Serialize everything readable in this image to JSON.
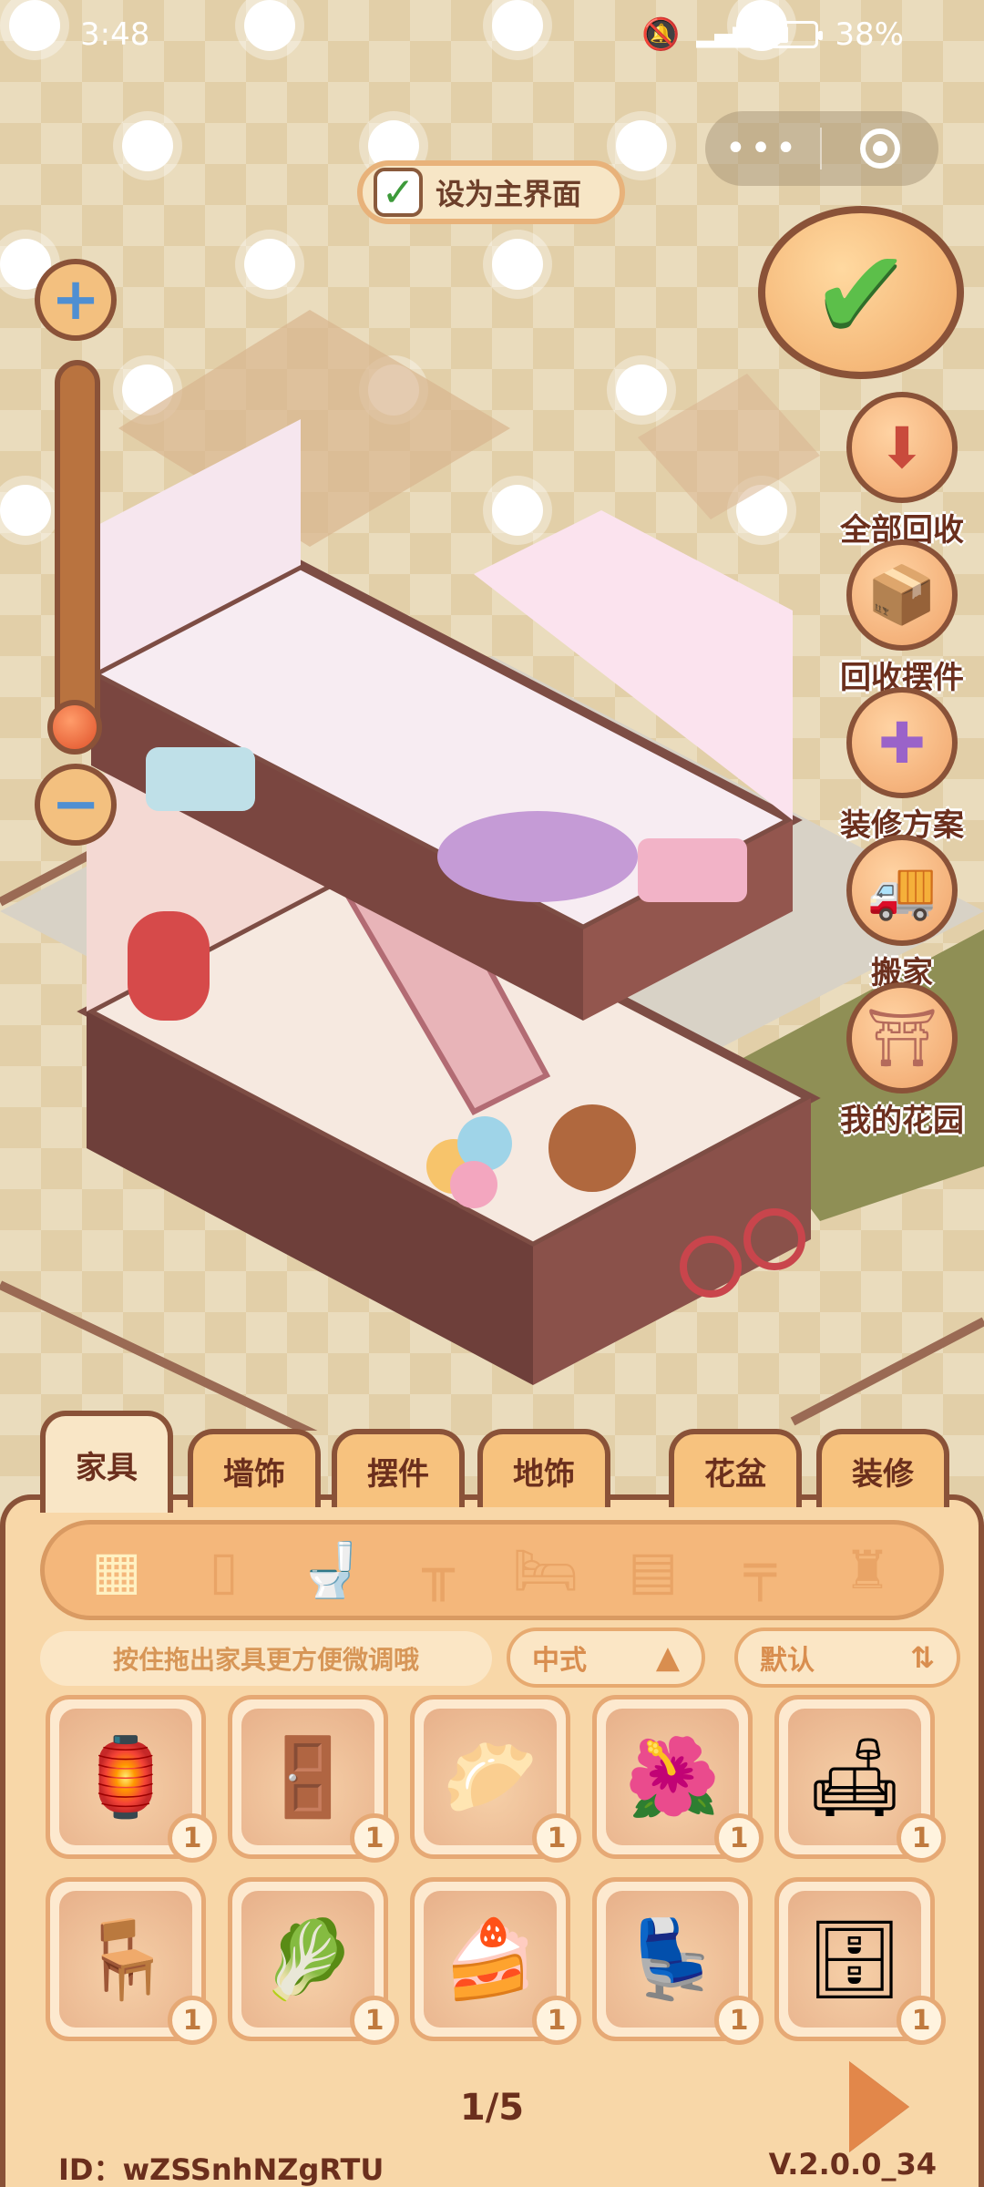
{
  "status_bar": {
    "time": "3:48",
    "battery": "38%",
    "battery_level": 0.38
  },
  "set_main": {
    "label": "设为主界面",
    "checked": true
  },
  "side_menu": [
    {
      "label": "全部回收",
      "icon": "recycle-all-box-icon"
    },
    {
      "label": "回收摆件",
      "icon": "recycle-ornament-box-icon"
    },
    {
      "label": "装修方案",
      "icon": "renovation-plan-icon"
    },
    {
      "label": "搬家",
      "icon": "moving-truck-icon"
    },
    {
      "label": "我的花园",
      "icon": "garden-arch-icon"
    }
  ],
  "tabs": [
    {
      "label": "家具",
      "active": true
    },
    {
      "label": "墙饰",
      "active": false
    },
    {
      "label": "摆件",
      "active": false
    },
    {
      "label": "地饰",
      "active": false
    },
    {
      "label": "花盆",
      "active": false
    },
    {
      "label": "装修",
      "active": false
    }
  ],
  "categories": [
    {
      "icon": "all-grid-icon",
      "active": true
    },
    {
      "icon": "fridge-icon",
      "active": false
    },
    {
      "icon": "toilet-icon",
      "active": false
    },
    {
      "icon": "stool-icon",
      "active": false
    },
    {
      "icon": "bed-icon",
      "active": false
    },
    {
      "icon": "cabinet-icon",
      "active": false
    },
    {
      "icon": "table-icon",
      "active": false
    },
    {
      "icon": "floor-lamp-icon",
      "active": false
    }
  ],
  "hint": "按住拖出家具更方便微调哦",
  "style_filter": {
    "value": "中式"
  },
  "sort": {
    "value": "默认"
  },
  "items": [
    {
      "icon": "street-lamp-icon",
      "qty": "1"
    },
    {
      "icon": "folding-screen-icon",
      "qty": "1"
    },
    {
      "icon": "food-stall-icon",
      "qty": "1"
    },
    {
      "icon": "potted-tree-icon",
      "qty": "1"
    },
    {
      "icon": "red-sofa-icon",
      "qty": "1"
    },
    {
      "icon": "red-bar-stool-icon",
      "qty": "1"
    },
    {
      "icon": "vegetable-stall-icon",
      "qty": "1"
    },
    {
      "icon": "display-counter-icon",
      "qty": "1"
    },
    {
      "icon": "booth-seat-icon",
      "qty": "1"
    },
    {
      "icon": "vending-cabinet-icon",
      "qty": "1"
    }
  ],
  "pagination": {
    "text": "1/5"
  },
  "footer": {
    "id": "ID：wZSSnhNZgRTU",
    "version": "V.2.0.0_34"
  }
}
